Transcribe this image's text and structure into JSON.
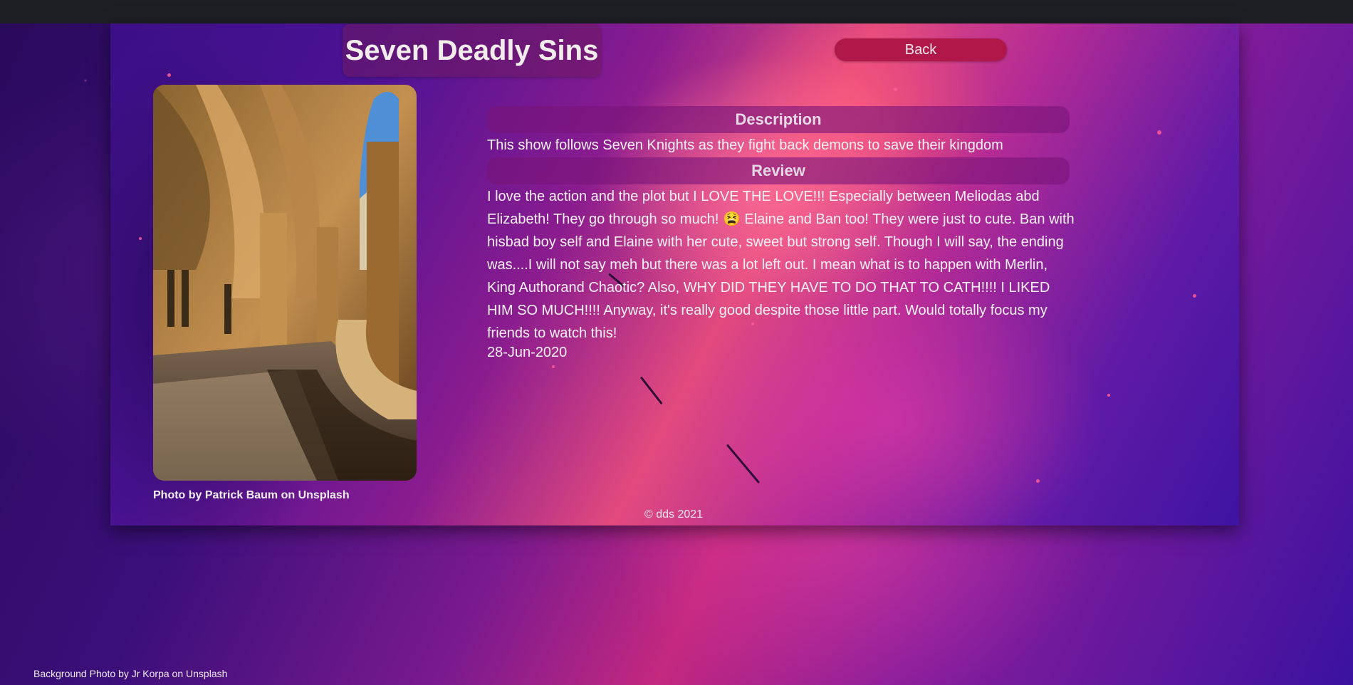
{
  "header": {
    "title": "Seven Deadly Sins",
    "back_label": "Back"
  },
  "photo": {
    "credit": "Photo by Patrick Baum on Unsplash"
  },
  "description": {
    "heading": "Description",
    "text": "This show follows Seven Knights as they fight back demons to save their kingdom"
  },
  "review": {
    "heading": "Review",
    "text": "I love the action and the plot but I LOVE THE LOVE!!! Especially between Meliodas abd Elizabeth! They go through so much! 😫 Elaine and Ban too! They were just to cute. Ban with hisbad boy self and Elaine with her cute, sweet but strong self. Though I will say, the ending was....I will not say meh but there was a lot left out. I mean what is to happen with Merlin, King Authorand Chaotic? Also, WHY DID THEY HAVE TO DO THAT TO CATH!!!! I LIKED HIM SO MUCH!!!! Anyway, it's really good despite those little part. Would totally focus my friends to watch this!",
    "date": "28-Jun-2020"
  },
  "footer": {
    "copyright": "© dds 2021",
    "background_credit": "Background Photo by Jr Korpa on Unsplash"
  },
  "colors": {
    "back_button": "#b0184a",
    "heading_bar": "#78147a",
    "text": "#fbf1f5"
  }
}
